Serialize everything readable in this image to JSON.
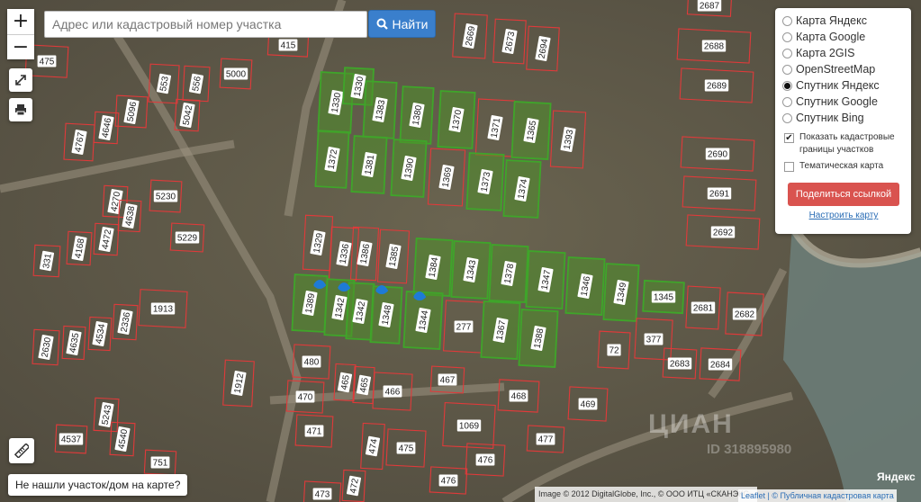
{
  "search": {
    "placeholder": "Адрес или кадастровый номер участка",
    "button_label": "Найти"
  },
  "zoom": {
    "in_label": "+",
    "out_label": "−"
  },
  "tools": {
    "fullscreen_icon": "expand-icon",
    "print_icon": "printer-icon",
    "ruler_icon": "ruler-icon"
  },
  "layers_panel": {
    "options": [
      {
        "label": "Карта Яндекс",
        "selected": false
      },
      {
        "label": "Карта Google",
        "selected": false
      },
      {
        "label": "Карта 2GIS",
        "selected": false
      },
      {
        "label": "OpenStreetMap",
        "selected": false
      },
      {
        "label": "Спутник Яндекс",
        "selected": true
      },
      {
        "label": "Спутник Google",
        "selected": false
      },
      {
        "label": "Спутник Bing",
        "selected": false
      }
    ],
    "show_cadastral_label": "Показать кадастровые границы участков",
    "show_cadastral_checked": true,
    "thematic_label": "Тематическая карта",
    "thematic_checked": false,
    "share_button": "Поделиться ссылкой",
    "settings_link": "Настроить карту"
  },
  "not_found_button": "Не нашли участок/дом на карте?",
  "attribution": "Image © 2012 DigitalGlobe, Inc., © ООО ИТЦ «СКАНЭКС»",
  "leaflet_link": "Leaflet | © Публичная кадастровая карта",
  "yandex_logo": "Яндекс",
  "watermark": "ЦИАН",
  "watermark_id": "ID 318895980",
  "colors": {
    "parcel_border": "#e03a3a",
    "highlight_fill": "#4e8f2a",
    "highlight_border": "#3fa52a",
    "marker": "#1e7bd6",
    "share": "#d9534f"
  },
  "parcels": [
    {
      "label": "475",
      "highlighted": false
    },
    {
      "label": "415",
      "highlighted": false
    },
    {
      "label": "5000",
      "highlighted": false
    },
    {
      "label": "553",
      "highlighted": false
    },
    {
      "label": "556",
      "highlighted": false
    },
    {
      "label": "5096",
      "highlighted": false
    },
    {
      "label": "5042",
      "highlighted": false
    },
    {
      "label": "4767",
      "highlighted": false
    },
    {
      "label": "4646",
      "highlighted": false
    },
    {
      "label": "5230",
      "highlighted": false
    },
    {
      "label": "4270",
      "highlighted": false
    },
    {
      "label": "4638",
      "highlighted": false
    },
    {
      "label": "5229",
      "highlighted": false
    },
    {
      "label": "4168",
      "highlighted": false
    },
    {
      "label": "4472",
      "highlighted": false
    },
    {
      "label": "331",
      "highlighted": false
    },
    {
      "label": "1913",
      "highlighted": false
    },
    {
      "label": "2336",
      "highlighted": false
    },
    {
      "label": "2630",
      "highlighted": false
    },
    {
      "label": "4635",
      "highlighted": false
    },
    {
      "label": "4534",
      "highlighted": false
    },
    {
      "label": "1912",
      "highlighted": false
    },
    {
      "label": "5243",
      "highlighted": false
    },
    {
      "label": "4537",
      "highlighted": false
    },
    {
      "label": "4540",
      "highlighted": false
    },
    {
      "label": "751",
      "highlighted": false
    },
    {
      "label": "2669",
      "highlighted": false
    },
    {
      "label": "2673",
      "highlighted": false
    },
    {
      "label": "2694",
      "highlighted": false
    },
    {
      "label": "2687",
      "highlighted": false
    },
    {
      "label": "2688",
      "highlighted": false
    },
    {
      "label": "2689",
      "highlighted": false
    },
    {
      "label": "1330",
      "highlighted": true
    },
    {
      "label": "1330",
      "highlighted": true
    },
    {
      "label": "1383",
      "highlighted": true
    },
    {
      "label": "1380",
      "highlighted": true
    },
    {
      "label": "1370",
      "highlighted": true
    },
    {
      "label": "1371",
      "highlighted": false
    },
    {
      "label": "1365",
      "highlighted": true
    },
    {
      "label": "1393",
      "highlighted": false
    },
    {
      "label": "1372",
      "highlighted": true
    },
    {
      "label": "1381",
      "highlighted": true
    },
    {
      "label": "1390",
      "highlighted": true
    },
    {
      "label": "1369",
      "highlighted": false
    },
    {
      "label": "1373",
      "highlighted": true
    },
    {
      "label": "1374",
      "highlighted": true
    },
    {
      "label": "2690",
      "highlighted": false
    },
    {
      "label": "2691",
      "highlighted": false
    },
    {
      "label": "2692",
      "highlighted": false
    },
    {
      "label": "1329",
      "highlighted": false
    },
    {
      "label": "1336",
      "highlighted": false
    },
    {
      "label": "1386",
      "highlighted": false
    },
    {
      "label": "1385",
      "highlighted": false
    },
    {
      "label": "1384",
      "highlighted": true
    },
    {
      "label": "1343",
      "highlighted": true
    },
    {
      "label": "1378",
      "highlighted": true
    },
    {
      "label": "1347",
      "highlighted": true
    },
    {
      "label": "1346",
      "highlighted": true
    },
    {
      "label": "1349",
      "highlighted": true
    },
    {
      "label": "1345",
      "highlighted": true
    },
    {
      "label": "2681",
      "highlighted": false
    },
    {
      "label": "2682",
      "highlighted": false
    },
    {
      "label": "1389",
      "highlighted": true
    },
    {
      "label": "1342",
      "highlighted": true
    },
    {
      "label": "1342",
      "highlighted": true
    },
    {
      "label": "1348",
      "highlighted": true
    },
    {
      "label": "1344",
      "highlighted": true
    },
    {
      "label": "277",
      "highlighted": false
    },
    {
      "label": "1367",
      "highlighted": true
    },
    {
      "label": "1388",
      "highlighted": true
    },
    {
      "label": "72",
      "highlighted": false
    },
    {
      "label": "377",
      "highlighted": false
    },
    {
      "label": "2683",
      "highlighted": false
    },
    {
      "label": "2684",
      "highlighted": false
    },
    {
      "label": "480",
      "highlighted": false
    },
    {
      "label": "465",
      "highlighted": false
    },
    {
      "label": "465",
      "highlighted": false
    },
    {
      "label": "470",
      "highlighted": false
    },
    {
      "label": "466",
      "highlighted": false
    },
    {
      "label": "467",
      "highlighted": false
    },
    {
      "label": "468",
      "highlighted": false
    },
    {
      "label": "469",
      "highlighted": false
    },
    {
      "label": "1069",
      "highlighted": false
    },
    {
      "label": "471",
      "highlighted": false
    },
    {
      "label": "474",
      "highlighted": false
    },
    {
      "label": "475",
      "highlighted": false
    },
    {
      "label": "477",
      "highlighted": false
    },
    {
      "label": "476",
      "highlighted": false
    },
    {
      "label": "476",
      "highlighted": false
    },
    {
      "label": "472",
      "highlighted": false
    },
    {
      "label": "473",
      "highlighted": false
    }
  ]
}
